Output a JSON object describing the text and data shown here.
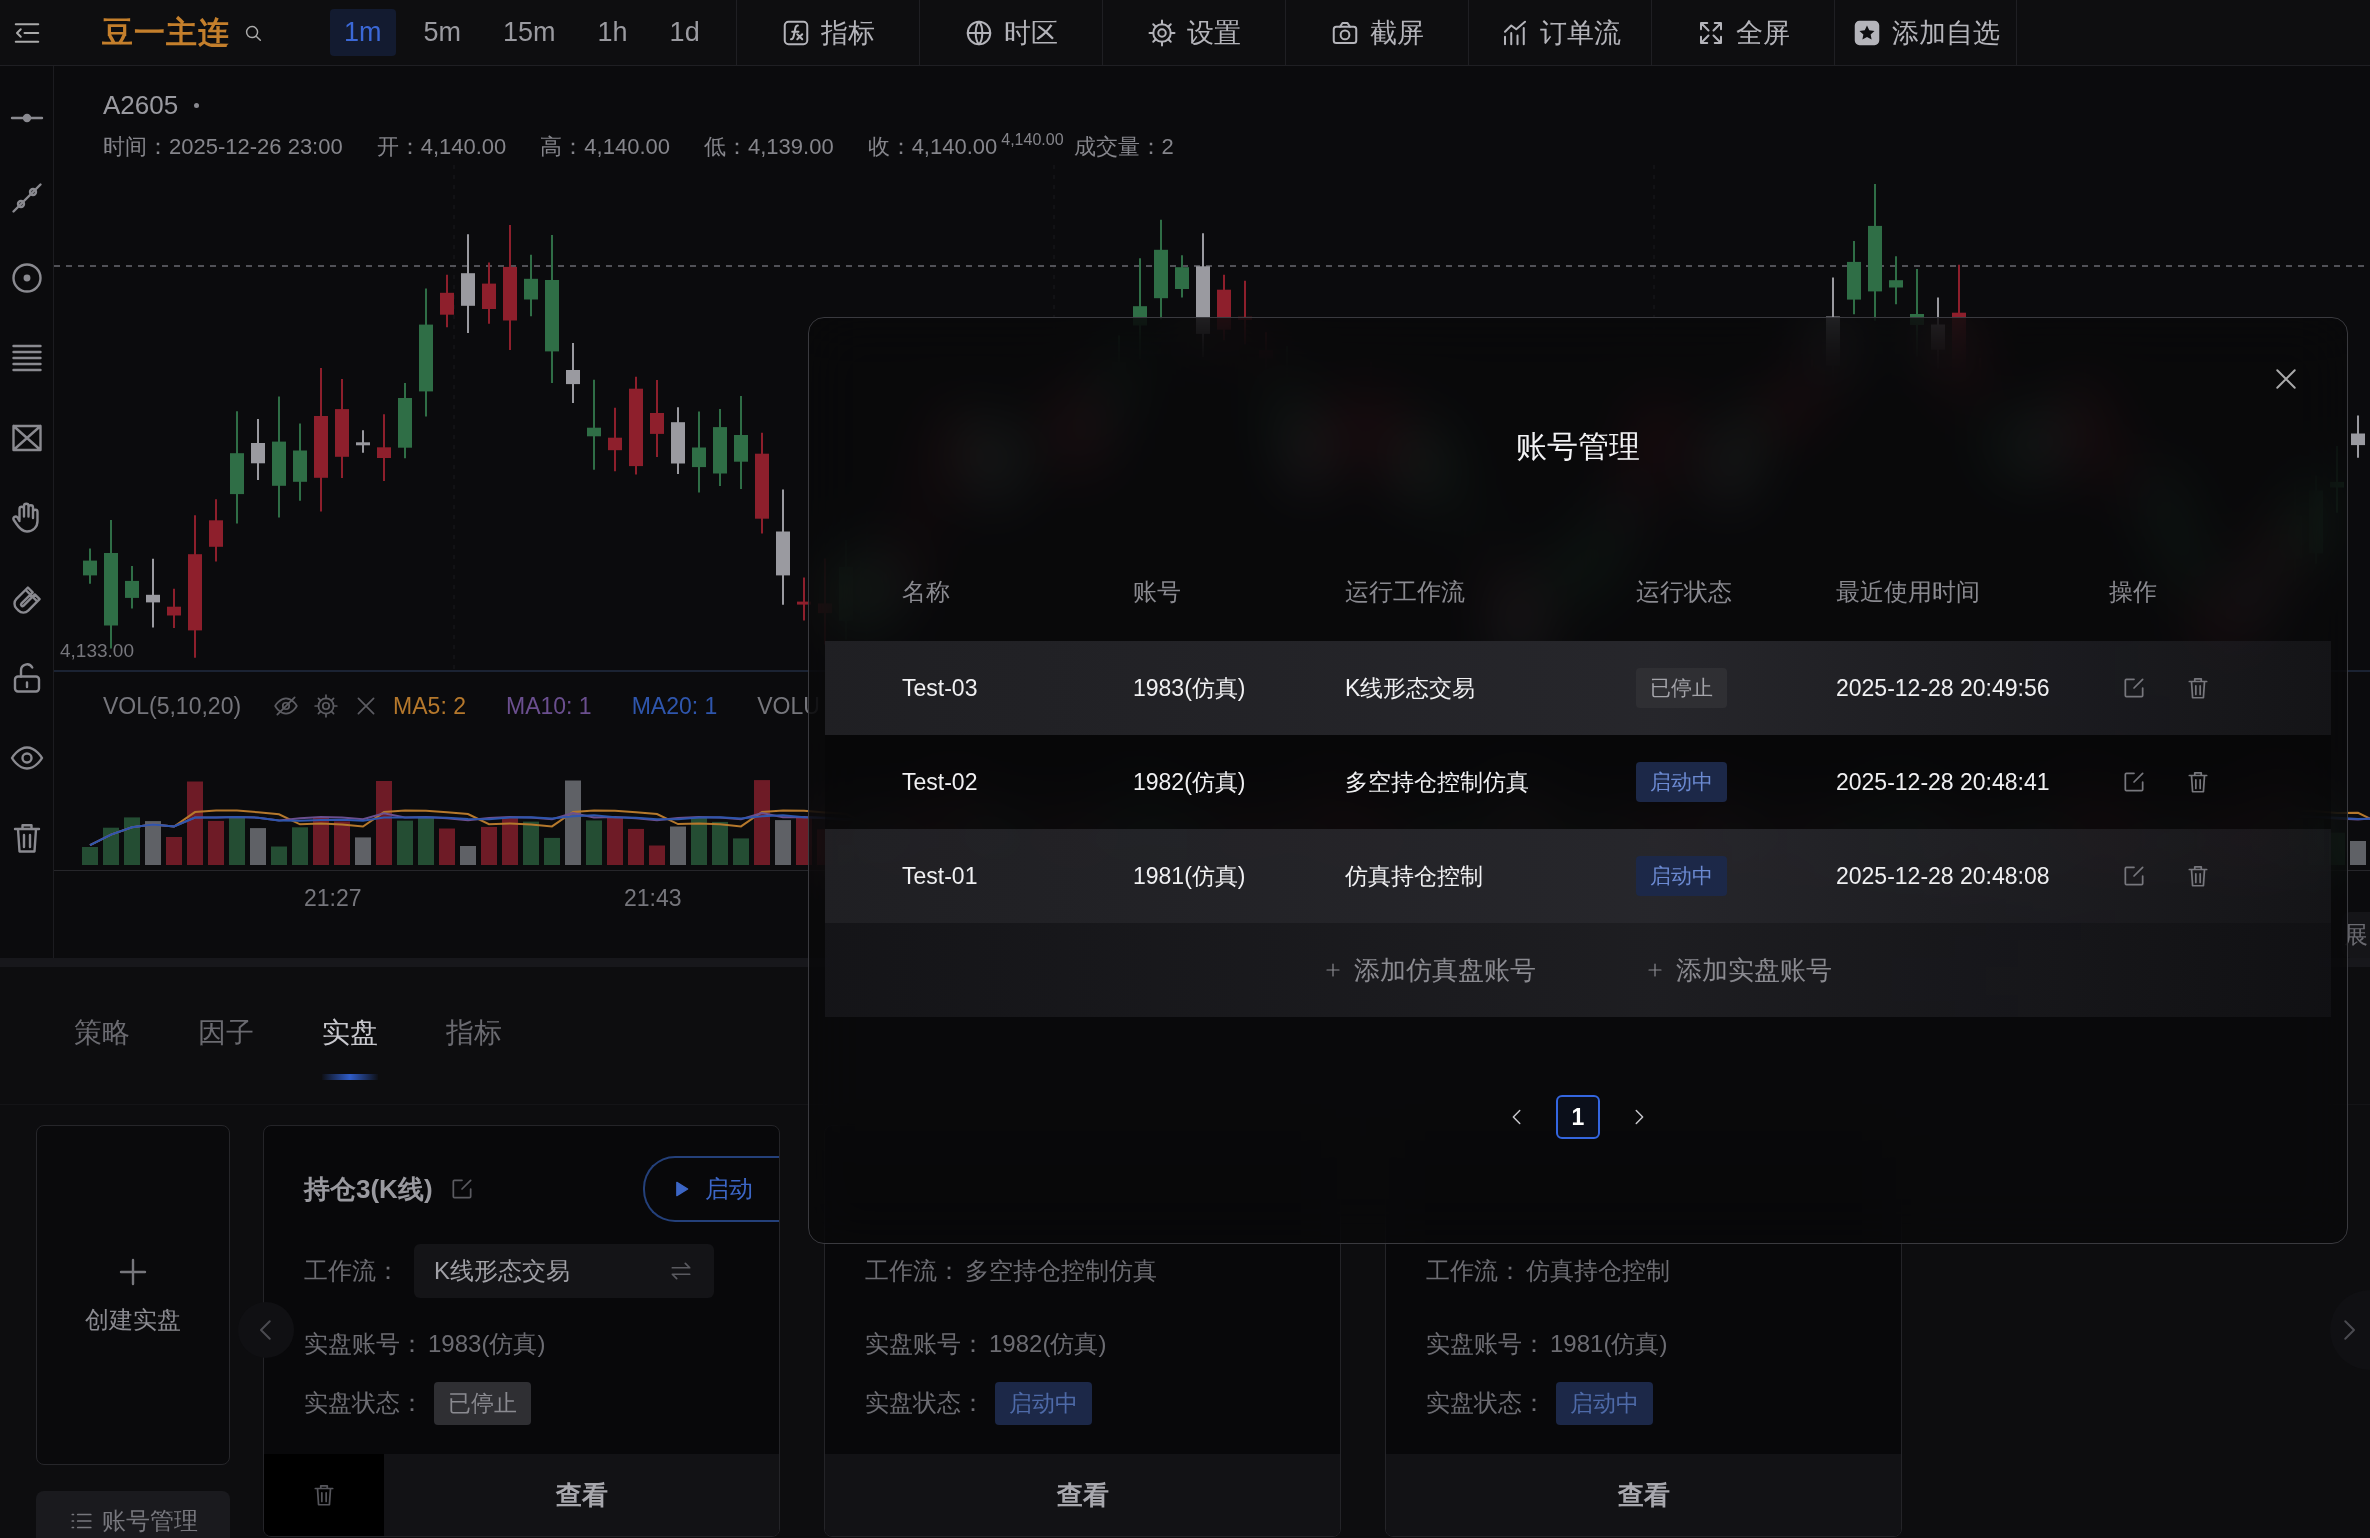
{
  "topbar": {
    "symbol": "豆一主连",
    "intervals": [
      {
        "label": "1m",
        "selected": true
      },
      {
        "label": "5m",
        "selected": false
      },
      {
        "label": "15m",
        "selected": false
      },
      {
        "label": "1h",
        "selected": false
      },
      {
        "label": "1d",
        "selected": false
      }
    ],
    "tools": [
      {
        "label": "指标"
      },
      {
        "label": "时区"
      },
      {
        "label": "设置"
      },
      {
        "label": "截屏"
      },
      {
        "label": "订单流"
      },
      {
        "label": "全屏"
      },
      {
        "label": "添加自选"
      }
    ]
  },
  "chart": {
    "symbol": "A2605",
    "fields": [
      "时间：2025-12-26 23:00",
      "开：4,140.00",
      "高：4,140.00",
      "低：4,139.00",
      "收：4,140.00"
    ],
    "price_tag": "4,140.00",
    "volume_field": "成交量：2",
    "price_label": "4,133.00",
    "time_labels": [
      "21:27",
      "21:43"
    ]
  },
  "volume": {
    "title": "VOL(5,10,20)",
    "averages": [
      {
        "label": "MA5: 2",
        "color": "#b5782c"
      },
      {
        "label": "MA10: 1",
        "color": "#6b4f8f"
      },
      {
        "label": "MA20: 1",
        "color": "#2f56ad"
      }
    ],
    "extra": "VOLU"
  },
  "panel": {
    "tabs": [
      {
        "label": "策略",
        "selected": false
      },
      {
        "label": "因子",
        "selected": false
      },
      {
        "label": "实盘",
        "selected": true
      },
      {
        "label": "指标",
        "selected": false
      }
    ],
    "create": "创建实盘",
    "manage": "账号管理",
    "cards": [
      {
        "kind": "full",
        "title": "持仓3(K线)",
        "start": "启动",
        "workflow_label": "工作流：",
        "workflow": "K线形态交易",
        "account_label": "实盘账号：",
        "account": "1983(仿真)",
        "status_label": "实盘状态：",
        "status": "已停止",
        "running": false,
        "view": "查看"
      },
      {
        "kind": "covered",
        "workflow_label": "工作流：",
        "workflow": "多空持仓控制仿真",
        "account_label": "实盘账号：",
        "account": "1982(仿真)",
        "status_label": "实盘状态：",
        "status": "启动中",
        "running": true,
        "view": "查看"
      },
      {
        "kind": "covered",
        "workflow_label": "工作流：",
        "workflow": "仿真持仓控制",
        "account_label": "实盘账号：",
        "account": "1981(仿真)",
        "status_label": "实盘状态：",
        "status": "启动中",
        "running": true,
        "view": "查看"
      }
    ]
  },
  "edge_tab": "展",
  "modal": {
    "title": "账号管理",
    "columns": [
      "名称",
      "账号",
      "运行工作流",
      "运行状态",
      "最近使用时间",
      "操作"
    ],
    "rows": [
      {
        "name": "Test-03",
        "account": "1983(仿真)",
        "workflow": "K线形态交易",
        "status": "已停止",
        "running": false,
        "last_used": "2025-12-28 20:49:56"
      },
      {
        "name": "Test-02",
        "account": "1982(仿真)",
        "workflow": "多空持仓控制仿真",
        "status": "启动中",
        "running": true,
        "last_used": "2025-12-28 20:48:41"
      },
      {
        "name": "Test-01",
        "account": "1981(仿真)",
        "workflow": "仿真持仓控制",
        "status": "启动中",
        "running": true,
        "last_used": "2025-12-28 20:48:08"
      }
    ],
    "add_links": [
      "添加仿真盘账号",
      "添加实盘账号"
    ],
    "pages": [
      {
        "label": "1",
        "selected": true
      }
    ]
  }
}
